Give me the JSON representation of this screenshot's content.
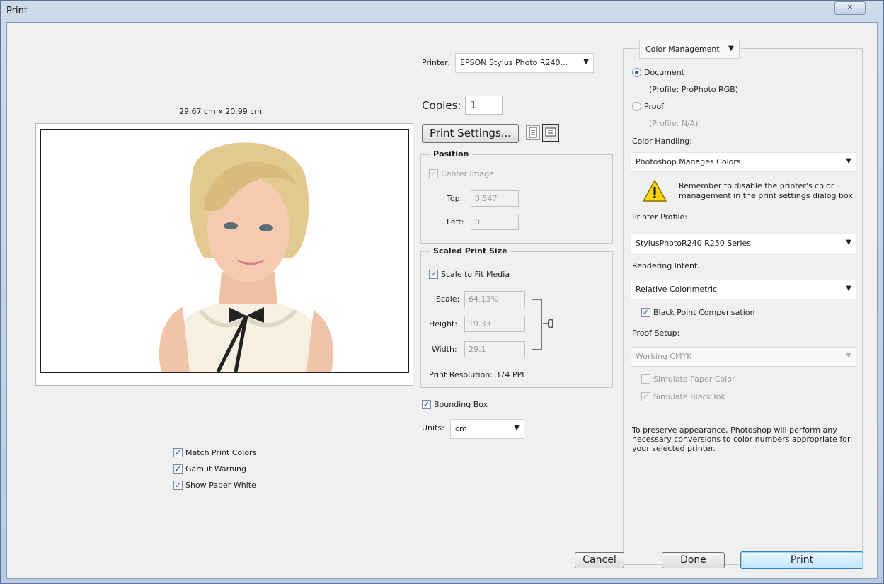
{
  "window": {
    "title": "Print",
    "close_glyph": "✕"
  },
  "preview": {
    "dimensions": "29.67 cm x 20.99 cm",
    "image_icon": "portrait-photo",
    "match_print_colors": "Match Print Colors",
    "gamut_warning": "Gamut Warning",
    "show_paper_white": "Show Paper White"
  },
  "printer": {
    "label": "Printer:",
    "value": "EPSON Stylus Photo R240..."
  },
  "copies": {
    "label": "Copies:",
    "value": "1"
  },
  "print_settings_label": "Print Settings...",
  "position": {
    "legend": "Position",
    "center_image": "Center Image",
    "top_label": "Top:",
    "top_value": "0.547",
    "left_label": "Left:",
    "left_value": "0"
  },
  "scaled": {
    "legend": "Scaled Print Size",
    "scale_to_fit": "Scale to Fit Media",
    "scale_label": "Scale:",
    "scale_value": "64.13%",
    "height_label": "Height:",
    "height_value": "19.33",
    "width_label": "Width:",
    "width_value": "29.1",
    "resolution": "Print Resolution: 374 PPI"
  },
  "bounding_box": "Bounding Box",
  "units": {
    "label": "Units:",
    "value": "cm"
  },
  "color_mgmt": {
    "header": "Color Management",
    "document": "Document",
    "document_profile": "(Profile: ProPhoto RGB)",
    "proof": "Proof",
    "proof_profile": "(Profile: N/A)",
    "handling_label": "Color Handling:",
    "handling_value": "Photoshop Manages Colors",
    "warning": "Remember to disable the printer's color management in the print settings dialog box.",
    "printer_profile_label": "Printer Profile:",
    "printer_profile_value": "StylusPhotoR240 R250 Series",
    "intent_label": "Rendering Intent:",
    "intent_value": "Relative Colorimetric",
    "bpc": "Black Point Compensation",
    "proof_setup_label": "Proof Setup:",
    "proof_setup_value": "Working CMYK",
    "sim_paper": "Simulate Paper Color",
    "sim_ink": "Simulate Black Ink",
    "note": "To preserve appearance, Photoshop will perform any necessary conversions to color numbers appropriate for your selected printer."
  },
  "buttons": {
    "cancel": "Cancel",
    "done": "Done",
    "print": "Print"
  },
  "colors": {
    "accent": "#3c7fb1",
    "warning": "#f5d50c"
  }
}
